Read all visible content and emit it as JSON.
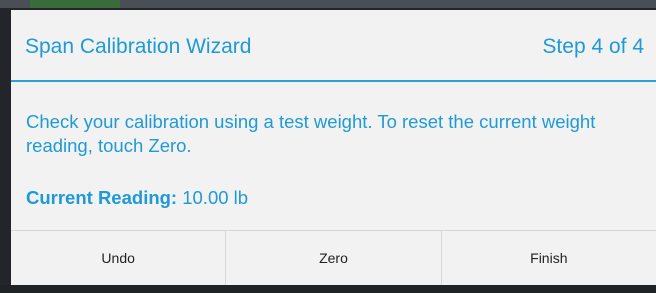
{
  "dialog": {
    "title": "Span Calibration Wizard",
    "step": "Step 4 of 4",
    "instructions": "Check your calibration using a test weight. To reset the current weight reading, touch Zero.",
    "reading_label": "Current Reading:",
    "reading_value": "10.00 lb",
    "buttons": {
      "undo": "Undo",
      "zero": "Zero",
      "finish": "Finish"
    }
  },
  "colors": {
    "accent": "#1e9ad6",
    "dialog_background": "#f2f2f2",
    "divider": "#2aa0d8"
  }
}
